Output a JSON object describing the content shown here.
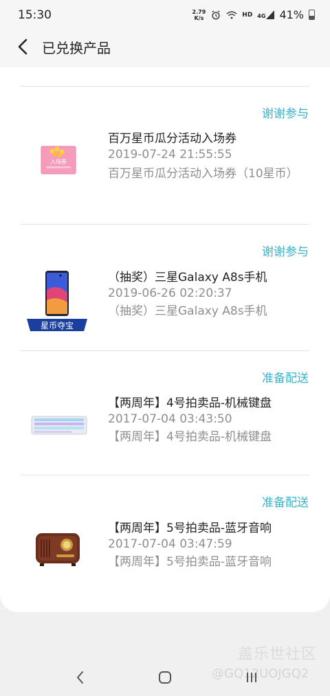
{
  "status_bar": {
    "time": "15:30",
    "net_speed_value": "2.79",
    "net_speed_unit": "K/s",
    "network_label": "HD",
    "signal_label": "4G",
    "battery_percent": "41%",
    "icons": [
      "alarm-icon",
      "wifi-icon",
      "signal-icon",
      "battery-icon"
    ]
  },
  "header": {
    "title": "已兑换产品",
    "back_icon": "back-arrow-icon"
  },
  "orders": [
    {
      "status": "谢谢参与",
      "name": "百万星币瓜分活动入场券",
      "date": "2019-07-24 21:55:55",
      "description": "百万星币瓜分活动入场券（10星币）",
      "thumbnail": "ticket-image",
      "thumbnail_text": "入场券"
    },
    {
      "status": "谢谢参与",
      "name": "（抽奖）三星Galaxy A8s手机",
      "date": "2019-06-26 02:20:37",
      "description": "（抽奖）三星Galaxy A8s手机",
      "thumbnail": "phone-image",
      "thumbnail_text": "星币夺宝"
    },
    {
      "status": "准备配送",
      "name": "【两周年】4号拍卖品-机械键盘",
      "date": "2017-07-04 03:43:50",
      "description": "【两周年】4号拍卖品-机械键盘",
      "thumbnail": "keyboard-image"
    },
    {
      "status": "准备配送",
      "name": "【两周年】5号拍卖品-蓝牙音响",
      "date": "2017-07-04 03:47:59",
      "description": "【两周年】5号拍卖品-蓝牙音响",
      "thumbnail": "speaker-image"
    }
  ],
  "watermark": {
    "title": "盖乐世社区",
    "user": "@GQ12UOJGQ2"
  },
  "nav_bar": {
    "icons": [
      "nav-back-icon",
      "nav-home-icon",
      "nav-recents-icon"
    ]
  },
  "colors": {
    "status_accent": "#3ab2c9",
    "secondary_text": "#8e8e8e",
    "page_background": "#f0f0f0",
    "card_background": "#ffffff"
  }
}
